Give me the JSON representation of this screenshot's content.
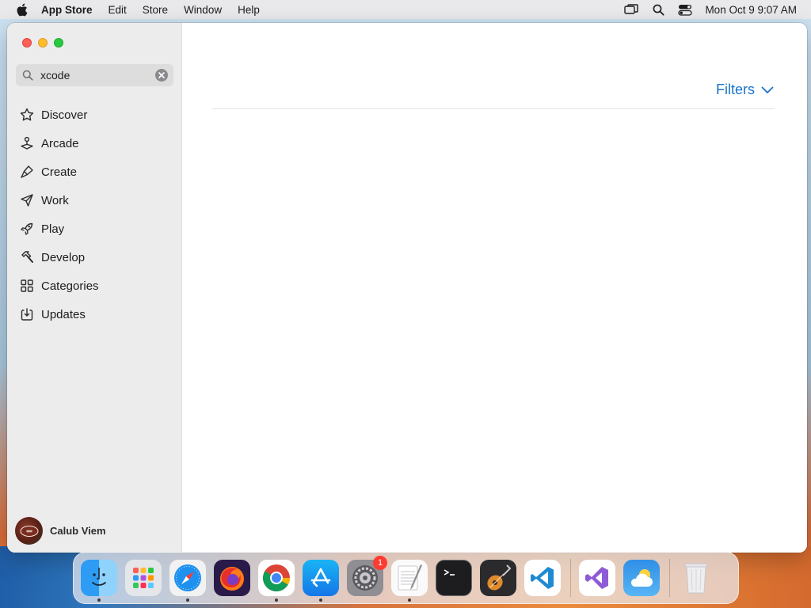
{
  "menubar": {
    "apple_icon": "apple-logo-icon",
    "items": [
      "App Store",
      "Edit",
      "Store",
      "Window",
      "Help"
    ],
    "status_icons": [
      "screen-mirroring-icon",
      "spotlight-search-icon",
      "control-center-icon"
    ],
    "clock": "Mon Oct 9  9:07 AM"
  },
  "window": {
    "search": {
      "value": "xcode",
      "placeholder": "Search"
    },
    "sidebar": {
      "items": [
        {
          "label": "Discover",
          "icon": "star-icon"
        },
        {
          "label": "Arcade",
          "icon": "joystick-icon"
        },
        {
          "label": "Create",
          "icon": "brush-icon"
        },
        {
          "label": "Work",
          "icon": "paper-plane-icon"
        },
        {
          "label": "Play",
          "icon": "rocket-icon"
        },
        {
          "label": "Develop",
          "icon": "hammer-icon"
        },
        {
          "label": "Categories",
          "icon": "grid-icon"
        },
        {
          "label": "Updates",
          "icon": "download-icon"
        }
      ]
    },
    "user": {
      "name": "Calub Viem"
    },
    "main": {
      "filters_label": "Filters"
    }
  },
  "dock": {
    "apps": [
      "Finder",
      "Launchpad",
      "Safari",
      "Firefox",
      "Google Chrome",
      "App Store",
      "System Settings",
      "TextEdit",
      "Terminal",
      "GarageBand",
      "Visual Studio Code",
      "Visual Studio",
      "Weather",
      "Trash"
    ],
    "system_settings_badge": "1"
  },
  "colors": {
    "accent": "#1a73c8",
    "badge": "#ff3b30"
  }
}
